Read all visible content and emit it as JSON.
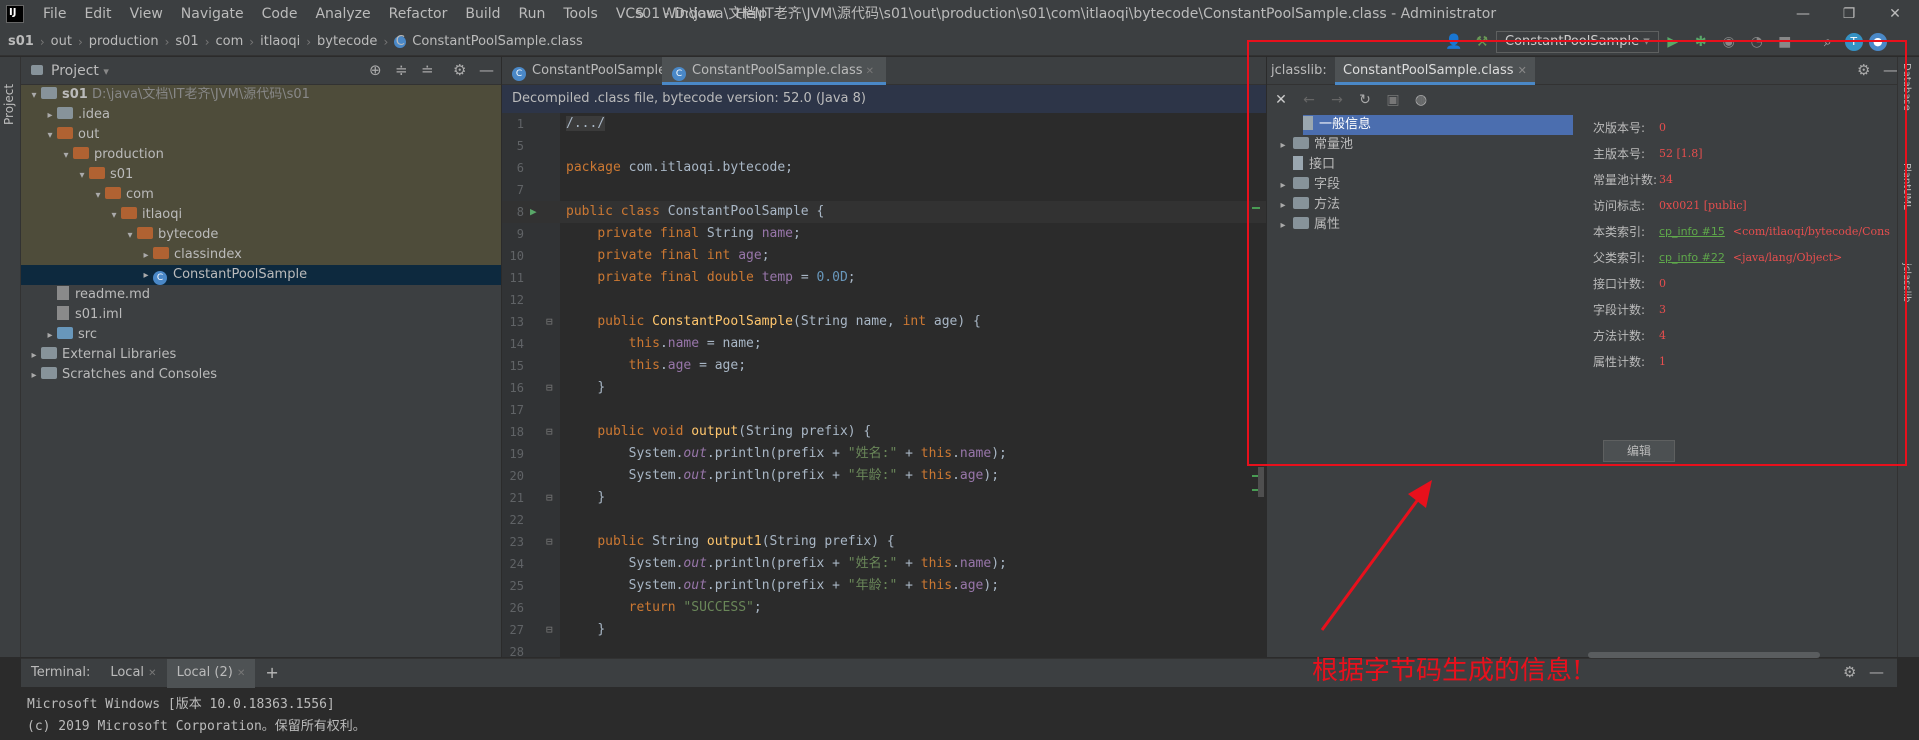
{
  "window": {
    "title": "s01 - D:\\java\\文档\\IT老齐\\JVM\\源代码\\s01\\out\\production\\s01\\com\\itlaoqi\\bytecode\\ConstantPoolSample.class - Administrator",
    "minimize": "—",
    "restore": "❐",
    "close": "✕"
  },
  "menu": [
    "File",
    "Edit",
    "View",
    "Navigate",
    "Code",
    "Analyze",
    "Refactor",
    "Build",
    "Run",
    "Tools",
    "VCS",
    "Window",
    "Help"
  ],
  "breadcrumb": [
    "s01",
    "out",
    "production",
    "s01",
    "com",
    "itlaoqi",
    "bytecode",
    "ConstantPoolSample.class"
  ],
  "run_config": "ConstantPoolSample",
  "left_stripe": {
    "project": "Project"
  },
  "project_panel": {
    "title": "Project",
    "tree": [
      {
        "indent": 0,
        "arrow": "▾",
        "icon": "fold gray",
        "label": "s01",
        "extra": " D:\\java\\文档\\IT老齐\\JVM\\源代码\\s01",
        "hl": true
      },
      {
        "indent": 1,
        "arrow": "▸",
        "icon": "fold gray",
        "label": ".idea",
        "extra": "",
        "hl": true
      },
      {
        "indent": 1,
        "arrow": "▾",
        "icon": "fold",
        "label": "out",
        "extra": "",
        "hl": true
      },
      {
        "indent": 2,
        "arrow": "▾",
        "icon": "fold",
        "label": "production",
        "extra": "",
        "hl": true
      },
      {
        "indent": 3,
        "arrow": "▾",
        "icon": "fold",
        "label": "s01",
        "extra": "",
        "hl": true
      },
      {
        "indent": 4,
        "arrow": "▾",
        "icon": "fold",
        "label": "com",
        "extra": "",
        "hl": true
      },
      {
        "indent": 5,
        "arrow": "▾",
        "icon": "fold",
        "label": "itlaoqi",
        "extra": "",
        "hl": true
      },
      {
        "indent": 6,
        "arrow": "▾",
        "icon": "fold",
        "label": "bytecode",
        "extra": "",
        "hl": true
      },
      {
        "indent": 7,
        "arrow": "▸",
        "icon": "fold",
        "label": "classindex",
        "extra": "",
        "hl": true
      },
      {
        "indent": 7,
        "arrow": "▸",
        "icon": "class",
        "label": "ConstantPoolSample",
        "extra": "",
        "sel": true
      },
      {
        "indent": 1,
        "arrow": "",
        "icon": "file",
        "label": "readme.md",
        "extra": ""
      },
      {
        "indent": 1,
        "arrow": "",
        "icon": "file",
        "label": "s01.iml",
        "extra": ""
      },
      {
        "indent": 1,
        "arrow": "▸",
        "icon": "fold blue",
        "label": "src",
        "extra": ""
      },
      {
        "indent": 0,
        "arrow": "▸",
        "icon": "fold gray",
        "label": "External Libraries",
        "extra": ""
      },
      {
        "indent": 0,
        "arrow": "▸",
        "icon": "fold gray",
        "label": "Scratches and Consoles",
        "extra": ""
      }
    ]
  },
  "editor": {
    "tabs": [
      {
        "label": "ConstantPoolSample.java",
        "active": false
      },
      {
        "label": "ConstantPoolSample.class",
        "active": true
      }
    ],
    "banner": "Decompiled .class file, bytecode version: 52.0 (Java 8)",
    "lines": [
      {
        "n": "1",
        "html": "<span class='pl' style='background:#3b3b3b'>/.../</span>"
      },
      {
        "n": "5",
        "html": ""
      },
      {
        "n": "6",
        "html": "<span class='kw'>package </span><span class='pl'>com.itlaoqi.bytecode;</span>"
      },
      {
        "n": "7",
        "html": ""
      },
      {
        "n": "8",
        "html": "<span class='kw'>public class </span><span class='pl'>ConstantPoolSample {</span>",
        "cur": true
      },
      {
        "n": "9",
        "html": "    <span class='kw'>private final </span><span class='pl'>String </span><span class='fld'>name</span><span class='pl'>;</span>"
      },
      {
        "n": "10",
        "html": "    <span class='kw'>private final int </span><span class='fld'>age</span><span class='pl'>;</span>"
      },
      {
        "n": "11",
        "html": "    <span class='kw'>private final double </span><span class='fld'>temp </span><span class='pl'>= </span><span class='num'>0.0D</span><span class='pl'>;</span>"
      },
      {
        "n": "12",
        "html": ""
      },
      {
        "n": "13",
        "html": "    <span class='kw'>public </span><span class='fn'>ConstantPoolSample</span><span class='pl'>(String name, </span><span class='kw'>int </span><span class='pl'>age) {</span>"
      },
      {
        "n": "14",
        "html": "        <span class='kw'>this</span><span class='pl'>.</span><span class='fld'>name </span><span class='pl'>= name;</span>"
      },
      {
        "n": "15",
        "html": "        <span class='kw'>this</span><span class='pl'>.</span><span class='fld'>age </span><span class='pl'>= age;</span>"
      },
      {
        "n": "16",
        "html": "    <span class='pl'>}</span>"
      },
      {
        "n": "17",
        "html": ""
      },
      {
        "n": "18",
        "html": "    <span class='kw'>public void </span><span class='fn'>output</span><span class='pl'>(String prefix) {</span>"
      },
      {
        "n": "19",
        "html": "        <span class='pl'>System.</span><span class='ital'>out</span><span class='pl'>.println(prefix + </span><span class='str'>\"姓名:\" </span><span class='pl'>+ </span><span class='kw'>this</span><span class='pl'>.</span><span class='fld'>name</span><span class='pl'>);</span>"
      },
      {
        "n": "20",
        "html": "        <span class='pl'>System.</span><span class='ital'>out</span><span class='pl'>.println(prefix + </span><span class='str'>\"年龄:\" </span><span class='pl'>+ </span><span class='kw'>this</span><span class='pl'>.</span><span class='fld'>age</span><span class='pl'>);</span>"
      },
      {
        "n": "21",
        "html": "    <span class='pl'>}</span>"
      },
      {
        "n": "22",
        "html": ""
      },
      {
        "n": "23",
        "html": "    <span class='kw'>public </span><span class='pl'>String </span><span class='fn'>output1</span><span class='pl'>(String prefix) {</span>"
      },
      {
        "n": "24",
        "html": "        <span class='pl'>System.</span><span class='ital'>out</span><span class='pl'>.println(prefix + </span><span class='str'>\"姓名:\" </span><span class='pl'>+ </span><span class='kw'>this</span><span class='pl'>.</span><span class='fld'>name</span><span class='pl'>);</span>"
      },
      {
        "n": "25",
        "html": "        <span class='pl'>System.</span><span class='ital'>out</span><span class='pl'>.println(prefix + </span><span class='str'>\"年龄:\" </span><span class='pl'>+ </span><span class='kw'>this</span><span class='pl'>.</span><span class='fld'>age</span><span class='pl'>);</span>"
      },
      {
        "n": "26",
        "html": "        <span class='kw'>return </span><span class='str'>\"SUCCESS\"</span><span class='pl'>;</span>"
      },
      {
        "n": "27",
        "html": "    <span class='pl'>}</span>"
      },
      {
        "n": "28",
        "html": ""
      }
    ]
  },
  "jclasslib": {
    "prefix": "jclasslib:",
    "tab": "ConstantPoolSample.class",
    "tree": [
      {
        "label": "一般信息",
        "arrow": "",
        "sel": true
      },
      {
        "label": "常量池",
        "arrow": "▸"
      },
      {
        "label": "接口",
        "arrow": ""
      },
      {
        "label": "字段",
        "arrow": "▸"
      },
      {
        "label": "方法",
        "arrow": "▸"
      },
      {
        "label": "属性",
        "arrow": "▸"
      }
    ],
    "info": [
      {
        "label": "次版本号:",
        "value": "0"
      },
      {
        "label": "主版本号:",
        "value": "52 [1.8]"
      },
      {
        "label": "常量池计数:",
        "value": "34"
      },
      {
        "label": "访问标志:",
        "value": "0x0021 [public]"
      },
      {
        "label": "本类索引:",
        "link": "cp_info #15",
        "value": "<com/itlaoqi/bytecode/Cons"
      },
      {
        "label": "父类索引:",
        "link": "cp_info #22",
        "value": "<java/lang/Object>"
      },
      {
        "label": "接口计数:",
        "value": "0"
      },
      {
        "label": "字段计数:",
        "value": "3"
      },
      {
        "label": "方法计数:",
        "value": "4"
      },
      {
        "label": "属性计数:",
        "value": "1"
      }
    ],
    "edit_button": "编辑"
  },
  "right_stripe": [
    "Database",
    "PlantUML",
    "jclasslib"
  ],
  "terminal": {
    "label": "Terminal:",
    "tabs": [
      "Local",
      "Local (2)"
    ],
    "add": "+",
    "lines": [
      "Microsoft Windows [版本 10.0.18363.1556]",
      "(c) 2019 Microsoft Corporation。保留所有权利。"
    ]
  },
  "annotation": {
    "text": "根据字节码生成的信息!",
    "color": "#e8101c"
  }
}
